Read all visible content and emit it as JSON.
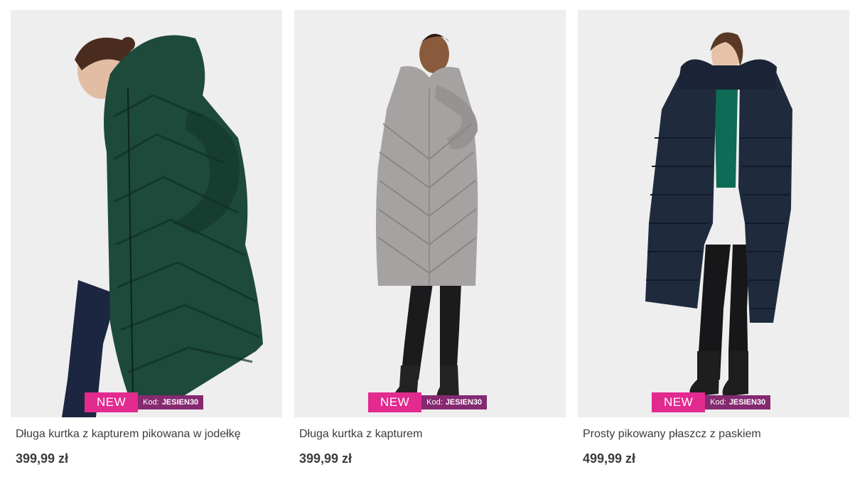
{
  "products": [
    {
      "title": "Długa kurtka z kapturem pikowana w jodełkę",
      "price": "399,99 zł",
      "badge_new": "NEW",
      "code_prefix": "Kod:",
      "code": "JESIEN30",
      "coat_color": "#1e4a3c"
    },
    {
      "title": "Długa kurtka z kapturem",
      "price": "399,99 zł",
      "badge_new": "NEW",
      "code_prefix": "Kod:",
      "code": "JESIEN30",
      "coat_color": "#a6a2a2"
    },
    {
      "title": "Prosty pikowany płaszcz z paskiem",
      "price": "499,99 zł",
      "badge_new": "NEW",
      "code_prefix": "Kod:",
      "code": "JESIEN30",
      "coat_color": "#1f2b3d"
    }
  ],
  "colors": {
    "badge_new_bg": "#e22a8f",
    "badge_code_bg": "#852a70",
    "photo_bg": "#eeeeef"
  }
}
